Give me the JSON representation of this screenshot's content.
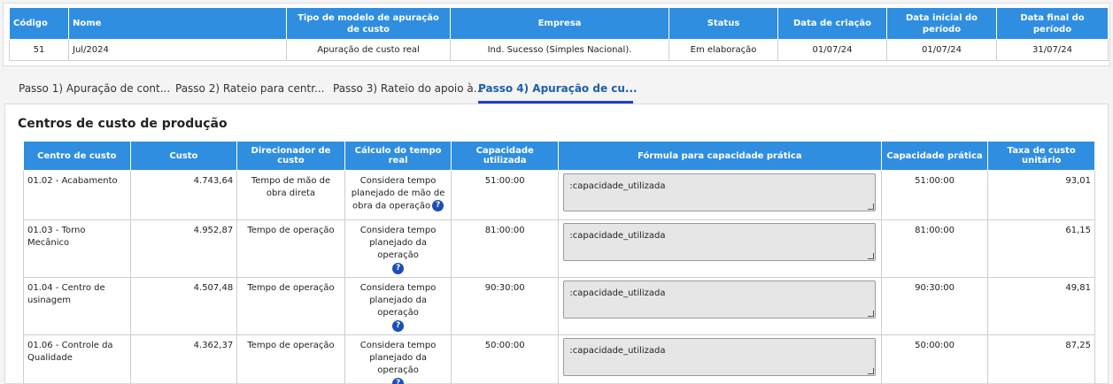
{
  "summary": {
    "headers": [
      "Código",
      "Nome",
      "Tipo de modelo de apuração de custo",
      "Empresa",
      "Status",
      "Data de criação",
      "Data inicial do período",
      "Data final do período"
    ],
    "row": {
      "codigo": "51",
      "nome": "Jul/2024",
      "tipo": "Apuração de custo real",
      "empresa": "Ind. Sucesso (Simples Nacional).",
      "status": "Em elaboração",
      "data_criacao": "01/07/24",
      "data_inicial": "01/07/24",
      "data_final": "31/07/24"
    }
  },
  "tabs": [
    {
      "label": "Passo 1) Apuração de cont..."
    },
    {
      "label": "Passo 2) Rateio para centr..."
    },
    {
      "label": "Passo 3) Rateio do apoio à..."
    },
    {
      "label": "Passo 4) Apuração de cu..."
    }
  ],
  "section": {
    "title": "Centros de custo de produção"
  },
  "cost_table": {
    "headers": [
      "Centro de custo",
      "Custo",
      "Direcionador de custo",
      "Cálculo do tempo real",
      "Capacidade utilizada",
      "Fórmula para capacidade prática",
      "Capacidade prática",
      "Taxa de custo unitário"
    ],
    "help_icon": "?",
    "rows": [
      {
        "centro": "01.02 - Acabamento",
        "custo": "4.743,64",
        "direcionador": "Tempo de mão de obra direta",
        "calculo": "Considera tempo planejado de mão de obra da operação",
        "cap_utilizada": "51:00:00",
        "formula": ":capacidade_utilizada",
        "cap_pratica": "51:00:00",
        "taxa": "93,01"
      },
      {
        "centro": "01.03 - Torno Mecânico",
        "custo": "4.952,87",
        "direcionador": "Tempo de operação",
        "calculo": "Considera tempo planejado da operação",
        "cap_utilizada": "81:00:00",
        "formula": ":capacidade_utilizada",
        "cap_pratica": "81:00:00",
        "taxa": "61,15"
      },
      {
        "centro": "01.04 - Centro de usinagem",
        "custo": "4.507,48",
        "direcionador": "Tempo de operação",
        "calculo": "Considera tempo planejado da operação",
        "cap_utilizada": "90:30:00",
        "formula": ":capacidade_utilizada",
        "cap_pratica": "90:30:00",
        "taxa": "49,81"
      },
      {
        "centro": "01.06 - Controle da Qualidade",
        "custo": "4.362,37",
        "direcionador": "Tempo de operação",
        "calculo": "Considera tempo planejado da operação",
        "cap_utilizada": "50:00:00",
        "formula": ":capacidade_utilizada",
        "cap_pratica": "50:00:00",
        "taxa": "87,25"
      }
    ]
  },
  "colors": {
    "header_blue": "#2f8ee0",
    "active_tab": "#1b5fa8",
    "help_icon": "#1a4fb8"
  }
}
